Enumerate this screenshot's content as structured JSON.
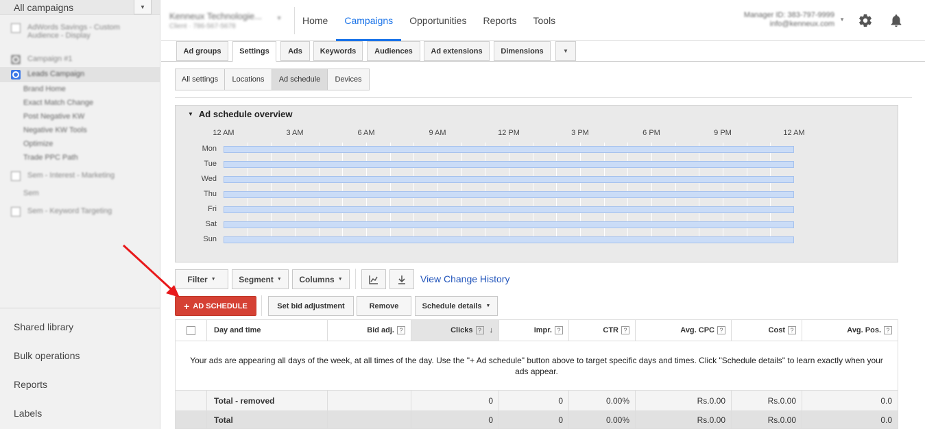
{
  "sidebar": {
    "header": "All campaigns",
    "tree": [
      {
        "label": "AdWords Savings - Custom Audience - Display",
        "icon": "grid"
      },
      {
        "label": "Campaign #1",
        "icon": "search"
      },
      {
        "label": "Leads Campaign",
        "icon": "search-blue"
      }
    ],
    "subitems": [
      "Brand Home",
      "Exact Match Change",
      "Post Negative KW",
      "Negative KW Tools",
      "Optimize",
      "Trade PPC Path"
    ],
    "tree2": [
      {
        "label": "Sem - Interest - Marketing",
        "icon": "grid"
      },
      {
        "label": "Sem",
        "icon": "none"
      },
      {
        "label": "Sem - Keyword Targeting",
        "icon": "grid"
      }
    ],
    "nav": [
      "Shared library",
      "Bulk operations",
      "Reports",
      "Labels"
    ]
  },
  "topbar": {
    "account_name": "Kenneux Technologie...",
    "account_id": "Client · 786-567-5678",
    "nav": [
      "Home",
      "Campaigns",
      "Opportunities",
      "Reports",
      "Tools"
    ],
    "active_nav": "Campaigns",
    "manager_line1": "Manager ID: 383-797-9999",
    "manager_line2": "info@kenneux.com"
  },
  "tabs": [
    "Ad groups",
    "Settings",
    "Ads",
    "Keywords",
    "Audiences",
    "Ad extensions",
    "Dimensions"
  ],
  "active_tab": "Settings",
  "subtabs": [
    "All settings",
    "Locations",
    "Ad schedule",
    "Devices"
  ],
  "active_subtab": "Ad schedule",
  "overview": {
    "title": "Ad schedule overview",
    "hours": [
      "12 AM",
      "3 AM",
      "6 AM",
      "9 AM",
      "12 PM",
      "3 PM",
      "6 PM",
      "9 PM",
      "12 AM"
    ],
    "days": [
      "Mon",
      "Tue",
      "Wed",
      "Thu",
      "Fri",
      "Sat",
      "Sun"
    ]
  },
  "toolbar": {
    "filter": "Filter",
    "segment": "Segment",
    "columns": "Columns",
    "view_history": "View Change History",
    "add_schedule": "AD SCHEDULE",
    "set_bid": "Set bid adjustment",
    "remove": "Remove",
    "schedule_details": "Schedule details"
  },
  "table": {
    "headers": [
      "Day and time",
      "Bid adj.",
      "Clicks",
      "Impr.",
      "CTR",
      "Avg. CPC",
      "Cost",
      "Avg. Pos."
    ],
    "message": "Your ads are appearing all days of the week, at all times of the day. Use the \"+ Ad schedule\" button above to target specific days and times. Click \"Schedule details\" to learn exactly when your ads appear.",
    "rows": [
      {
        "label": "Total - removed",
        "clicks": "0",
        "impr": "0",
        "ctr": "0.00%",
        "avg_cpc": "Rs.0.00",
        "cost": "Rs.0.00",
        "avg_pos": "0.0"
      },
      {
        "label": "Total",
        "clicks": "0",
        "impr": "0",
        "ctr": "0.00%",
        "avg_cpc": "Rs.0.00",
        "cost": "Rs.0.00",
        "avg_pos": "0.0"
      }
    ]
  },
  "colors": {
    "accent": "#1a73e8",
    "add_button": "#d54134",
    "schedule_band": "#cadcf7",
    "annotation_arrow": "#e8191b"
  }
}
